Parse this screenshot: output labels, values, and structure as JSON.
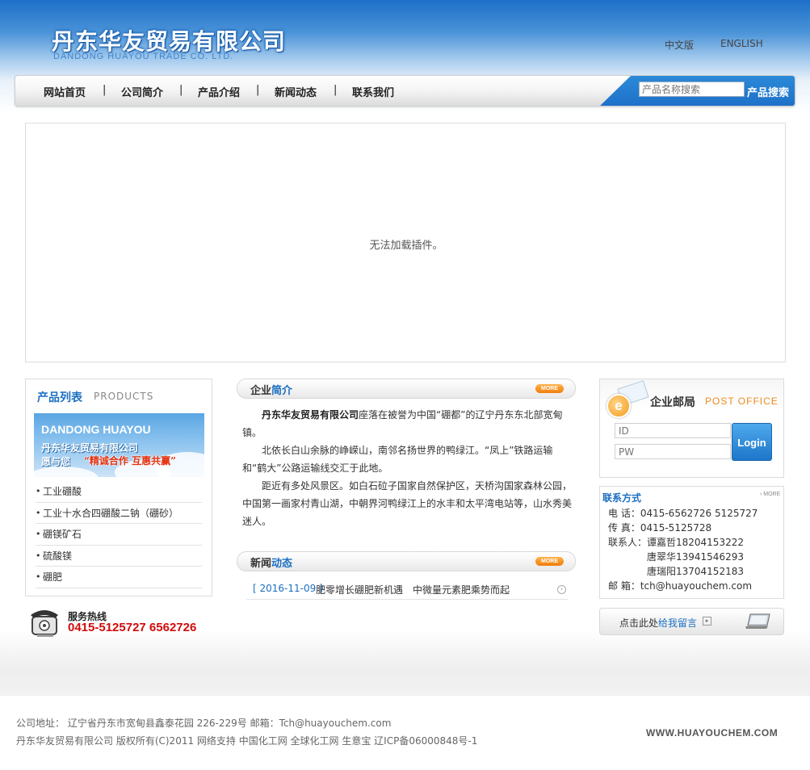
{
  "header": {
    "logo_cn": "丹东华友贸易有限公司",
    "logo_en": "DANDONG HUAYOU TRADE CO. LTD.",
    "lang_cn": "中文版",
    "lang_en": "ENGLISH"
  },
  "nav": {
    "items": [
      {
        "label": "网站首页"
      },
      {
        "label": "公司简介"
      },
      {
        "label": "产品介绍"
      },
      {
        "label": "新闻动态"
      },
      {
        "label": "联系我们"
      }
    ],
    "separator": "|",
    "search_placeholder": "产品名称搜索",
    "search_button": "产品搜索"
  },
  "flash": {
    "message": "无法加载插件。"
  },
  "products": {
    "title_cn": "产品列表",
    "title_en": "PRODUCTS",
    "banner_en": "DANDONG HUAYOU",
    "banner_company": "丹东华友贸易有限公司",
    "banner_slogan_a": "愿与您",
    "banner_slogan_b": "“精诚合作  互惠共赢”",
    "items": [
      {
        "label": "工业硼酸"
      },
      {
        "label": "工业十水合四硼酸二钠（硼砂）"
      },
      {
        "label": "硼镁矿石"
      },
      {
        "label": "硫酸镁"
      },
      {
        "label": "硼肥"
      }
    ]
  },
  "hotline": {
    "label": "服务热线",
    "number": "0415-5125727 6562726"
  },
  "intro": {
    "title_a": "企业",
    "title_b": "简介",
    "more": "MORE",
    "company": "丹东华友贸易有限公司",
    "p1_rest": "座落在被誉为中国“硼都”的辽宁丹东东北部宽甸镇。",
    "p2": "北依长白山余脉的峥嵘山，南邻名扬世界的鸭绿江。“凤上”铁路运输和“鹤大”公路运输线交汇于此地。",
    "p3": "距近有多处风景区。如白石砬子国家自然保护区，天桥沟国家森林公园，中国第一画家村青山湖，中朝界河鸭绿江上的水丰和太平湾电站等，山水秀美迷人。"
  },
  "news": {
    "title_a": "新闻",
    "title_b": "动态",
    "more": "MORE",
    "items": [
      {
        "date": "[ 2016-11-09 ]",
        "title": "肥零增长硼肥新机遇　中微量元素肥乘势而起"
      }
    ]
  },
  "post_office": {
    "title_cn": "企业邮局",
    "title_en": "POST OFFICE",
    "id_placeholder": "ID",
    "pw_placeholder": "PW",
    "login_label": "Login"
  },
  "contact": {
    "title": "联系方式",
    "more": "MORE",
    "phone": "电 话：0415-6562726 5125727",
    "fax": "传 真：0415-5125728",
    "person1": "联系人：谭嘉哲18204153222",
    "person2": "唐翠华13941546293",
    "person3": "唐瑞阳13704152183",
    "email": "邮 箱：tch@huayouchem.com"
  },
  "message": {
    "prefix": "点击此处",
    "link": "给我留言"
  },
  "footer": {
    "line1": "公司地址： 辽宁省丹东市宽甸县鑫泰花园 226-229号 邮箱：Tch@huayouchem.com",
    "line2": "丹东华友贸易有限公司  版权所有(C)2011 网络支持 中国化工网 全球化工网 生意宝  辽ICP备06000848号-1",
    "site": "WWW.HUAYOUCHEM.COM"
  },
  "colors": {
    "brand_blue": "#1b6fc1",
    "hotline_red": "#d10b0b",
    "more_orange": "#f07d0c"
  }
}
